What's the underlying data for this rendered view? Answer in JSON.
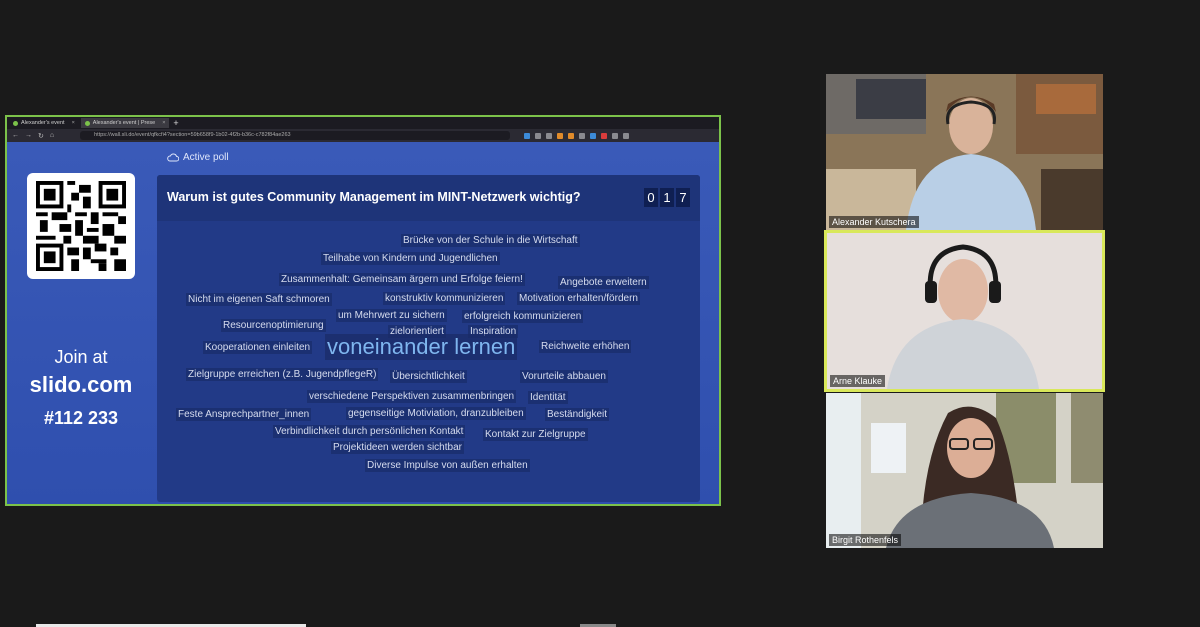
{
  "browser": {
    "tabs": [
      {
        "label": "Alexander's event"
      },
      {
        "label": "Alexander's event | Prese"
      }
    ],
    "url": "https://wall.sli.do/event/qfkcfi4?section=59b658f9-1b02-4f2b-b36c-c782f84ae263"
  },
  "slido": {
    "join_label": "Join at",
    "site": "slido.com",
    "code": "#112 233",
    "active_poll": "Active poll",
    "question": "Warum ist gutes Community Management im MINT-Netzwerk wichtig?",
    "count_digits": [
      "0",
      "1",
      "7"
    ],
    "words": [
      "Brücke von der Schule in die Wirtschaft",
      "Teilhabe von Kindern und Jugendlichen",
      "Zusammenhalt: Gemeinsam ärgern und Erfolge feiern!",
      "Angebote erweitern",
      "Nicht im eigenen Saft schmoren",
      "konstruktiv kommunizieren",
      "Motivation erhalten/fördern",
      "um Mehrwert zu sichern",
      "erfolgreich kommunizieren",
      "Resourcenoptimierung",
      "zielorientiert",
      "Inspiration",
      "Kooperationen einleiten",
      "voneinander lernen",
      "Reichweite erhöhen",
      "Zielgruppe erreichen (z.B. JugendpflegeR)",
      "Übersichtlichkeit",
      "Vorurteile abbauen",
      "verschiedene Perspektiven zusammenbringen",
      "Identität",
      "Feste Ansprechpartner_innen",
      "gegenseitige Motiviation, dranzubleiben",
      "Beständigkeit",
      "Verbindlichkeit durch persönlichen Kontakt",
      "Kontakt zur Zielgruppe",
      "Projektideen werden sichtbar",
      "Diverse Impulse von außen erhalten"
    ]
  },
  "participants": [
    {
      "name": "Alexander Kutschera"
    },
    {
      "name": "Arne Klauke"
    },
    {
      "name": "Birgit Rothenfels"
    }
  ],
  "colors": {
    "share_border": "#7cc24a",
    "active_speaker": "#d9e85a",
    "slido_bg": "#2f4fae",
    "highlight_word": "#7fb6ef"
  }
}
